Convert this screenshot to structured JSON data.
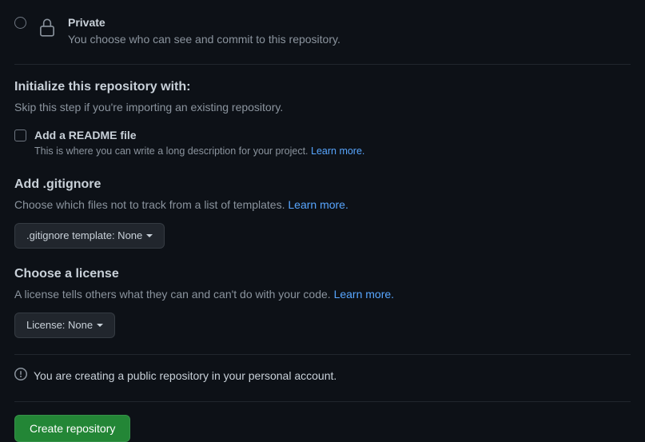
{
  "visibility": {
    "private": {
      "title": "Private",
      "description": "You choose who can see and commit to this repository."
    }
  },
  "initialize": {
    "heading": "Initialize this repository with:",
    "sub": "Skip this step if you're importing an existing repository."
  },
  "readme": {
    "label": "Add a README file",
    "description": "This is where you can write a long description for your project. ",
    "learn_more": "Learn more."
  },
  "gitignore": {
    "heading": "Add .gitignore",
    "description": "Choose which files not to track from a list of templates. ",
    "learn_more": "Learn more.",
    "button": ".gitignore template: None"
  },
  "license": {
    "heading": "Choose a license",
    "description": "A license tells others what they can and can't do with your code. ",
    "learn_more": "Learn more.",
    "button": "License: None"
  },
  "info": {
    "text": "You are creating a public repository in your personal account."
  },
  "create_button": "Create repository"
}
